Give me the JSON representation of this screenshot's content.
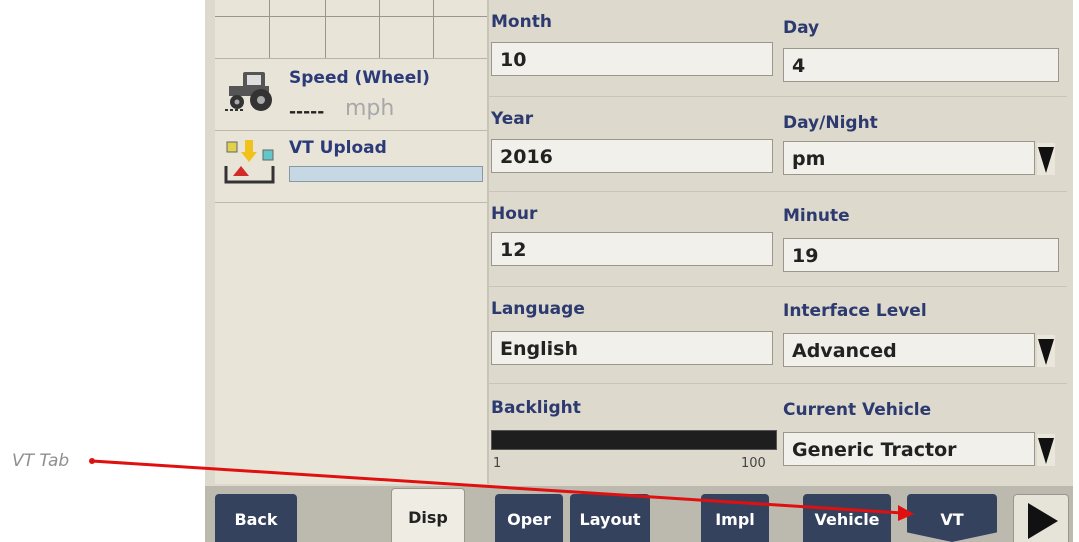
{
  "left_panel": {
    "speed": {
      "title": "Speed (Wheel)",
      "value": "-----",
      "unit": "mph"
    },
    "vt_upload": {
      "title": "VT Upload"
    }
  },
  "settings": {
    "month": {
      "label": "Month",
      "value": "10"
    },
    "day": {
      "label": "Day",
      "value": "4"
    },
    "year": {
      "label": "Year",
      "value": "2016"
    },
    "day_night": {
      "label": "Day/Night",
      "value": "pm"
    },
    "hour": {
      "label": "Hour",
      "value": "12"
    },
    "minute": {
      "label": "Minute",
      "value": "19"
    },
    "language": {
      "label": "Language",
      "value": "English"
    },
    "interface_level": {
      "label": "Interface Level",
      "value": "Advanced"
    },
    "backlight": {
      "label": "Backlight",
      "min": "1",
      "max": "100"
    },
    "current_vehicle": {
      "label": "Current Vehicle",
      "value": "Generic Tractor"
    }
  },
  "tabs": {
    "back": "Back",
    "disp": "Disp",
    "oper": "Oper",
    "layout": "Layout",
    "impl": "Impl",
    "vehicle": "Vehicle",
    "vt": "VT"
  },
  "annotation": {
    "label": "VT Tab",
    "color": "#e01010"
  },
  "icons": {
    "tractor": "tractor-icon",
    "vt_upload": "vt-upload-icon",
    "dropdown": "triangle-down-icon",
    "next": "triangle-right-icon"
  }
}
